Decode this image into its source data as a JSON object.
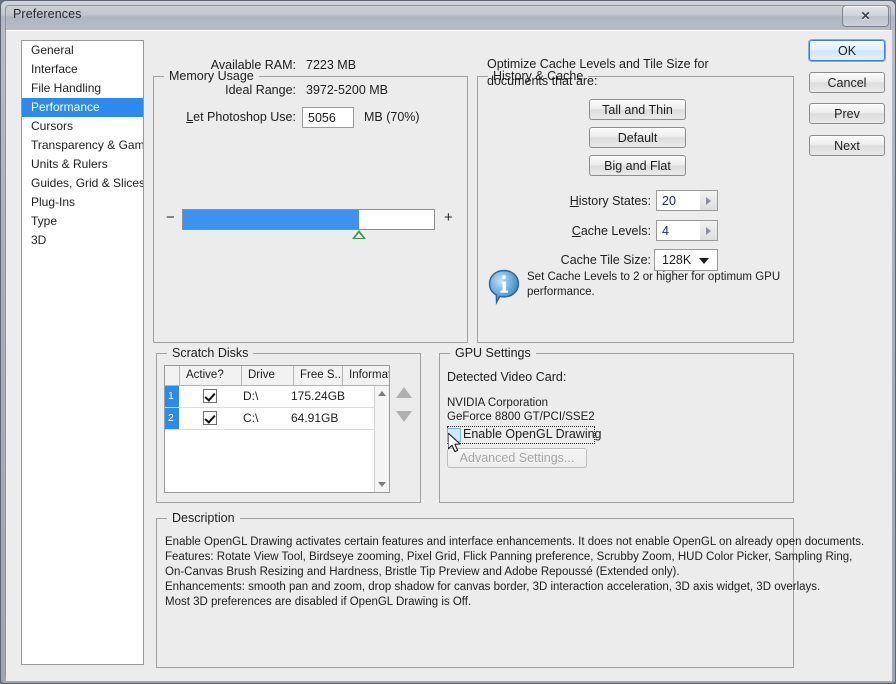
{
  "window": {
    "title": "Preferences",
    "close_label": "✕"
  },
  "sidebar": {
    "items": [
      {
        "label": "General",
        "selected": false
      },
      {
        "label": "Interface",
        "selected": false
      },
      {
        "label": "File Handling",
        "selected": false
      },
      {
        "label": "Performance",
        "selected": true
      },
      {
        "label": "Cursors",
        "selected": false
      },
      {
        "label": "Transparency & Gamut",
        "selected": false
      },
      {
        "label": "Units & Rulers",
        "selected": false
      },
      {
        "label": "Guides, Grid & Slices",
        "selected": false
      },
      {
        "label": "Plug-Ins",
        "selected": false
      },
      {
        "label": "Type",
        "selected": false
      },
      {
        "label": "3D",
        "selected": false
      }
    ]
  },
  "memory_usage": {
    "group_title": "Memory Usage",
    "available_ram_label": "Available RAM:",
    "available_ram_value": "7223 MB",
    "ideal_range_label": "Ideal Range:",
    "ideal_range_value": "3972-5200 MB",
    "let_use_label": "Let Photoshop Use:",
    "let_use_value": "5056",
    "let_use_suffix": "MB (70%)",
    "slider_percent": 70,
    "minus_label": "−",
    "plus_label": "+"
  },
  "history_cache": {
    "group_title": "History & Cache",
    "optimize_line1": "Optimize Cache Levels and Tile Size for",
    "optimize_line2": "documents that are:",
    "buttons": [
      {
        "label": "Tall and Thin"
      },
      {
        "label": "Default"
      },
      {
        "label": "Big and Flat"
      }
    ],
    "history_states_label": "History States:",
    "history_states_value": "20",
    "cache_levels_label": "Cache Levels:",
    "cache_levels_value": "4",
    "cache_tile_label": "Cache Tile Size:",
    "cache_tile_value": "128K",
    "tip_line1": "Set Cache Levels to 2 or higher for optimum GPU",
    "tip_line2": "performance."
  },
  "scratch_disks": {
    "group_title": "Scratch Disks",
    "columns": [
      "",
      "Active?",
      "Drive",
      "Free S...",
      "Information"
    ],
    "rows": [
      {
        "num": "1",
        "active": true,
        "drive": "D:\\",
        "free": "175.24GB",
        "info": ""
      },
      {
        "num": "2",
        "active": true,
        "drive": "C:\\",
        "free": "64.91GB",
        "info": ""
      }
    ]
  },
  "gpu_settings": {
    "group_title": "GPU Settings",
    "detected_label": "Detected Video Card:",
    "vendor": "NVIDIA Corporation",
    "model": "GeForce 8800 GT/PCI/SSE2",
    "enable_opengl_label": "Enable OpenGL Drawing",
    "enable_opengl_checked": false,
    "advanced_settings_label": "Advanced Settings...",
    "advanced_settings_enabled": false
  },
  "description": {
    "group_title": "Description",
    "lines": [
      "Enable OpenGL Drawing activates certain features and interface enhancements. It does not enable OpenGL on already open documents.",
      "Features: Rotate View Tool, Birdseye zooming, Pixel Grid, Flick Panning preference, Scrubby Zoom, HUD Color Picker, Sampling Ring,",
      "On-Canvas Brush Resizing and Hardness, Bristle Tip Preview and Adobe Repoussé (Extended only).",
      "Enhancements: smooth pan and zoom, drop shadow for canvas border, 3D interaction acceleration, 3D axis widget, 3D overlays.",
      "Most 3D preferences are disabled if OpenGL Drawing is Off."
    ]
  },
  "actions": {
    "ok_label": "OK",
    "cancel_label": "Cancel",
    "prev_label": "Prev",
    "next_label": "Next"
  },
  "colors": {
    "selection_blue": "#2b8aee",
    "slider_blue": "#3b93ef",
    "marker_green": "#3f9b4a",
    "dialog_bg": "#ececec"
  }
}
